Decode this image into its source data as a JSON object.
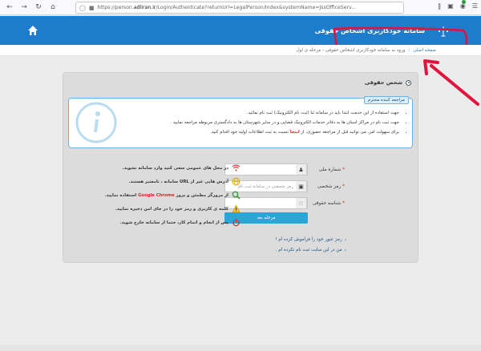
{
  "browser": {
    "url_prefix": "https://person.",
    "url_host": "adliran.ir",
    "url_rest": "/Login/Authenticate?returnUrl=LegalPerson/Index&systemName=JssOfficeServ..."
  },
  "header": {
    "title": "سامانه خودکاربری اشخاص حقوقی"
  },
  "breadcrumb": {
    "home": "صفحه اصلی",
    "current": "ورود به سامانه خودکاربری اشخاص حقوقی - مرحله ی اول"
  },
  "panel": {
    "heading": "شخص حقوقی"
  },
  "notice": {
    "tab": "مراجعه کننده محترم",
    "items": [
      "جهت استفاده از این خدمت ابتدا باید در سامانه ثنا (ثبت نام الکترونیک) ثبت نام نمائید.",
      "جهت ثبت نام در مراکز استان ها به دفاتر خدمات الکترونیک قضایی و در سایر شهرستان ها به دادگستری مربوطه مراجعه نمایید .",
      "برای سهولت امر، می توانید قبل از مراجعه حضوری، از",
      "اینجا",
      "نسبت به ثبت اطلاعات اولیه خود اقدام کنید."
    ]
  },
  "form": {
    "national_id_label": "شماره ملی",
    "password_label": "رمز شخصی",
    "password_placeholder": "رمز شخصی در سامانه ثبت نام",
    "legal_id_label": "شناسه حقوقی",
    "required_mark": "*",
    "submit_label": "مرحله بعد"
  },
  "links": {
    "forgot": "رمز عبور خود را فراموش کرده ام !",
    "not_registered": "من در این سایت ثبت نام نکرده ام ."
  },
  "tips": [
    {
      "icon": "wifi-warning-icon",
      "text": "در محل های عمومی سعی کنید وارد سامانه نشوید."
    },
    {
      "icon": "globe-icon",
      "text_before": "آدرس هایی غیر از ",
      "text_mid": "URL",
      "text_after": " سامانه ، نامعتبر هستند."
    },
    {
      "icon": "magnifier-icon",
      "text_before": "از مرورگر مطمئن و بروز ",
      "text_red": "Google Chrome",
      "text_after": " استفاده نمایید."
    },
    {
      "icon": "warning-icon",
      "text": "کلمه ی کاربری و رمز خود را در جای امن ذخیره نمایید."
    },
    {
      "icon": "power-icon",
      "text": "پس از انجام و اتمام کار، حتما از سامانه خارج شوید."
    }
  ],
  "colors": {
    "header_blue": "#1e7ccd",
    "button_blue": "#2aa5d6",
    "annotation_red": "#e0143c"
  }
}
